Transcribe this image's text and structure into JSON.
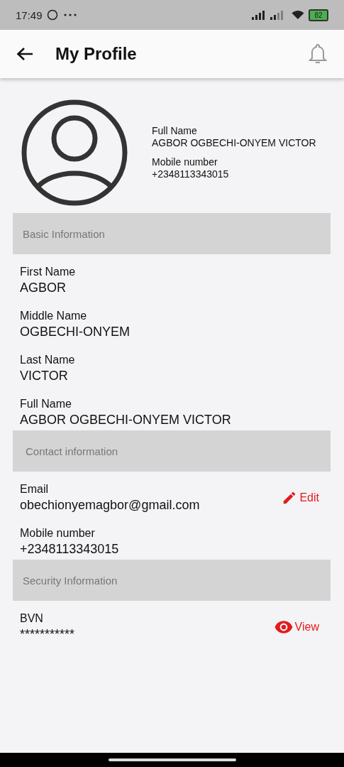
{
  "status_bar": {
    "time": "17:49",
    "battery": "82"
  },
  "app_bar": {
    "title": "My Profile"
  },
  "profile": {
    "fields": [
      {
        "label": "Full Name",
        "value": "AGBOR OGBECHI-ONYEM VICTOR"
      },
      {
        "label": "Mobile number",
        "value": "+2348113343015"
      }
    ]
  },
  "sections": [
    {
      "title": "Basic Information",
      "fields": [
        {
          "label": "First Name",
          "value": "AGBOR"
        },
        {
          "label": "Middle Name",
          "value": "OGBECHI-ONYEM"
        },
        {
          "label": "Last Name",
          "value": "VICTOR"
        },
        {
          "label": "Full Name",
          "value": "AGBOR OGBECHI-ONYEM VICTOR"
        }
      ]
    },
    {
      "title": "Contact information",
      "fields": [
        {
          "label": "Email",
          "value": "obechionyemagbor@gmail.com",
          "action": {
            "kind": "edit",
            "label": "Edit"
          }
        },
        {
          "label": "Mobile number",
          "value": "+2348113343015"
        }
      ]
    },
    {
      "title": "Security Information",
      "fields": [
        {
          "label": "BVN",
          "value": "***********",
          "action": {
            "kind": "view",
            "label": "View"
          }
        }
      ]
    }
  ]
}
